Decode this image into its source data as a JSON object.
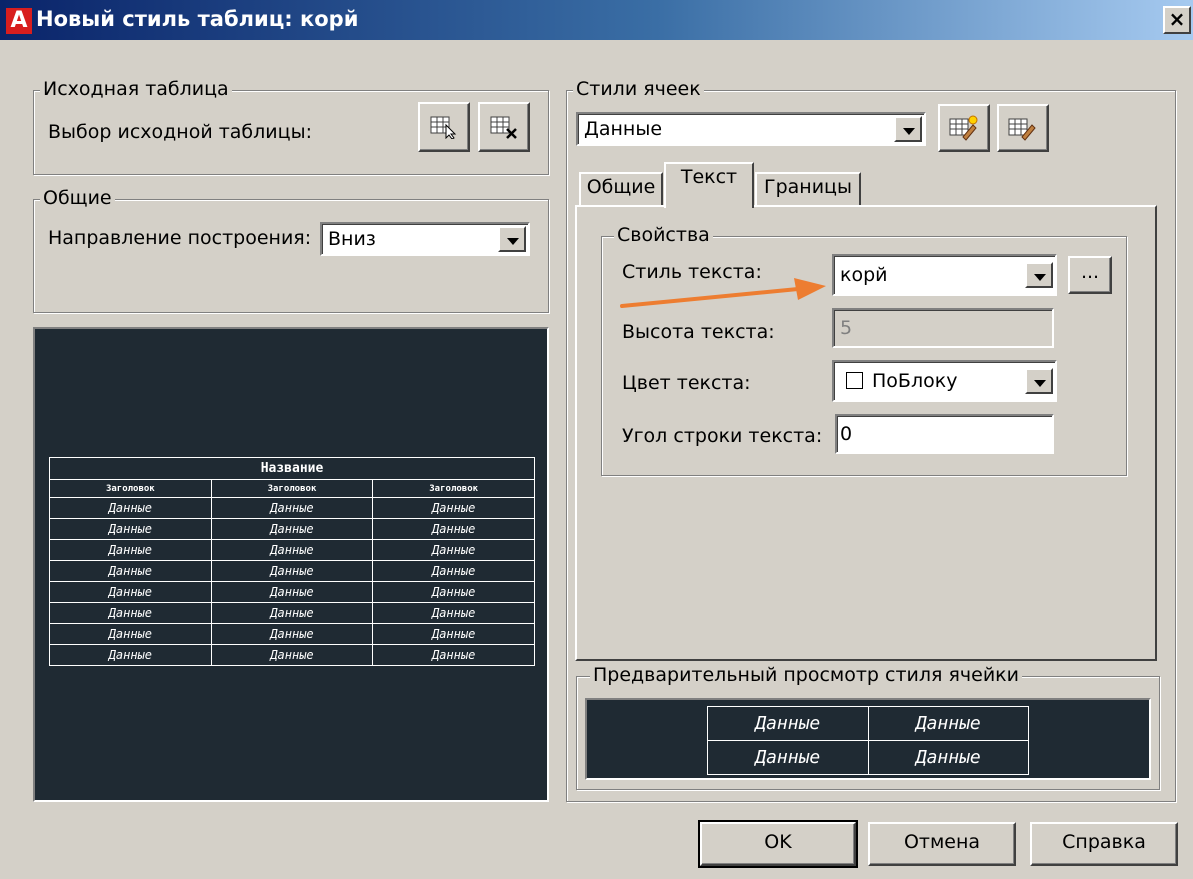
{
  "window": {
    "icon_letter": "A",
    "title": "Новый стиль таблиц: корй",
    "close_label": "×"
  },
  "source_table": {
    "group_label": "Исходная таблица",
    "select_label": "Выбор исходной таблицы:",
    "buttons": [
      "select-table-icon",
      "remove-table-icon"
    ]
  },
  "general": {
    "group_label": "Общие",
    "direction_label": "Направление построения:",
    "direction_value": "Вниз"
  },
  "table_preview": {
    "title": "Название",
    "header_cells": [
      "Заголовок",
      "Заголовок",
      "Заголовок"
    ],
    "data_rows": [
      [
        "Данные",
        "Данные",
        "Данные"
      ],
      [
        "Данные",
        "Данные",
        "Данные"
      ],
      [
        "Данные",
        "Данные",
        "Данные"
      ],
      [
        "Данные",
        "Данные",
        "Данные"
      ],
      [
        "Данные",
        "Данные",
        "Данные"
      ],
      [
        "Данные",
        "Данные",
        "Данные"
      ],
      [
        "Данные",
        "Данные",
        "Данные"
      ],
      [
        "Данные",
        "Данные",
        "Данные"
      ]
    ]
  },
  "cell_styles": {
    "group_label": "Стили ячеек",
    "selected": "Данные",
    "buttons": [
      "new-cell-style-icon",
      "manage-cell-styles-icon"
    ]
  },
  "tabs": [
    {
      "label": "Общие",
      "active": false
    },
    {
      "label": "Текст",
      "active": true
    },
    {
      "label": "Границы",
      "active": false
    }
  ],
  "properties": {
    "group_label": "Свойства",
    "text_style_label": "Стиль текста:",
    "text_style_value": "корй",
    "browse_label": "...",
    "text_height_label": "Высота текста:",
    "text_height_value": "5",
    "text_color_label": "Цвет текста:",
    "text_color_value": "ПоБлоку",
    "text_angle_label": "Угол строки текста:",
    "text_angle_value": "0"
  },
  "cell_preview": {
    "group_label": "Предварительный просмотр стиля ячейки",
    "rows": [
      [
        "Данные",
        "Данные"
      ],
      [
        "Данные",
        "Данные"
      ]
    ]
  },
  "footer": {
    "ok": "OK",
    "cancel": "Отмена",
    "help": "Справка"
  },
  "colors": {
    "dialog_bg": "#d4d0c8",
    "titlebar_start": "#0a246a",
    "preview_bg": "#1f2a33",
    "arrow_annotation": "#ed7d31"
  }
}
